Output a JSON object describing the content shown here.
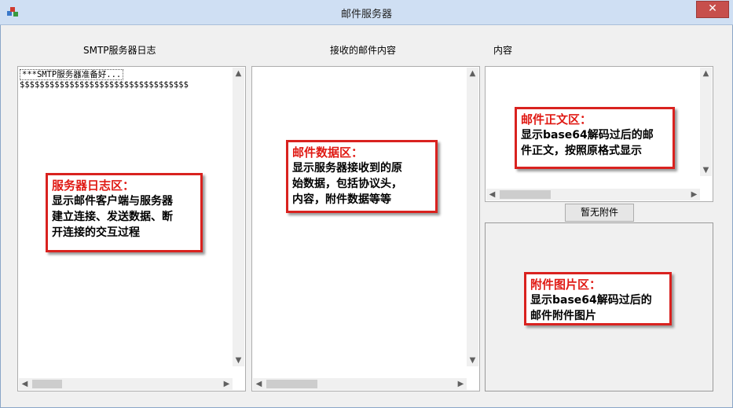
{
  "window": {
    "title": "邮件服务器",
    "close_label": "✕"
  },
  "labels": {
    "log": "SMTP服务器日志",
    "received": "接收的邮件内容",
    "content": "内容"
  },
  "log_lines": [
    "***SMTP服务器准备好...",
    "$$$$$$$$$$$$$$$$$$$$$$$$$$$$$$$$$$"
  ],
  "attachment_button": "暂无附件",
  "annotations": {
    "log": {
      "title": "服务器日志区：",
      "lines": [
        "显示邮件客户端与服务器",
        "建立连接、发送数据、断",
        "开连接的交互过程"
      ]
    },
    "data": {
      "title": "邮件数据区：",
      "lines": [
        "显示服务器接收到的原",
        "始数据，包括协议头，",
        "内容，附件数据等等"
      ]
    },
    "body": {
      "title": "邮件正文区：",
      "lines": [
        "显示base64解码过后的邮",
        "件正文，按照原格式显示"
      ]
    },
    "image": {
      "title": "附件图片区：",
      "lines": [
        "显示base64解码过后的",
        "邮件附件图片"
      ]
    }
  },
  "colors": {
    "annotation_border": "#d9221f",
    "annotation_title": "#e01a14",
    "titlebar": "#cfdff3",
    "close": "#c74f4c"
  }
}
